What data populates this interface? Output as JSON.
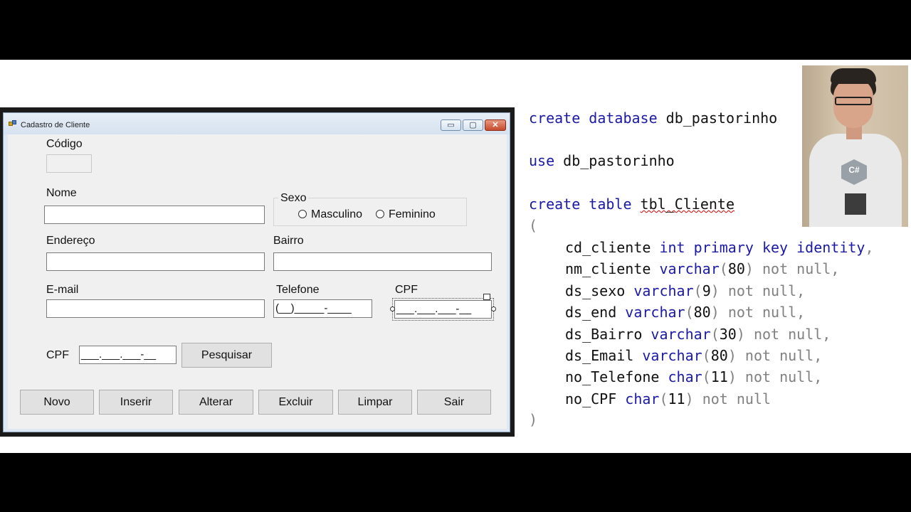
{
  "window": {
    "title": "Cadastro de Cliente",
    "minimize_glyph": "▭",
    "maximize_glyph": "▢",
    "close_glyph": "✕"
  },
  "form": {
    "codigo_label": "Código",
    "nome_label": "Nome",
    "sexo_label": "Sexo",
    "radio_masculino": "Masculino",
    "radio_feminino": "Feminino",
    "endereco_label": "Endereço",
    "bairro_label": "Bairro",
    "email_label": "E-mail",
    "telefone_label": "Telefone",
    "telefone_mask": "(__)_____-____",
    "cpf_label": "CPF",
    "cpf_mask": "___.___.___-__",
    "search_cpf_label": "CPF",
    "search_cpf_mask": "___.___.___-__",
    "pesquisar_button": "Pesquisar"
  },
  "buttons": {
    "novo": "Novo",
    "inserir": "Inserir",
    "alterar": "Alterar",
    "excluir": "Excluir",
    "limpar": "Limpar",
    "sair": "Sair"
  },
  "code": {
    "l1_kw": "create database",
    "l1_name": " db_pastorinho",
    "l2_kw": "use",
    "l2_name": " db_pastorinho",
    "l3_kw": "create table",
    "l3_name": "tbl_Cliente",
    "open_paren": "(",
    "close_paren": ")",
    "columns": [
      {
        "name": "cd_cliente",
        "type": "int primary key identity",
        "size": "",
        "tail": ","
      },
      {
        "name": "nm_cliente",
        "type": "varchar",
        "size": "80",
        "tail": " not null,"
      },
      {
        "name": "ds_sexo",
        "type": "varchar",
        "size": "9",
        "tail": " not null,"
      },
      {
        "name": "ds_end",
        "type": "varchar",
        "size": "80",
        "tail": " not null,"
      },
      {
        "name": "ds_Bairro",
        "type": "varchar",
        "size": "30",
        "tail": " not null,"
      },
      {
        "name": "ds_Email",
        "type": "varchar",
        "size": "80",
        "tail": " not null,"
      },
      {
        "name": "no_Telefone",
        "type": "char",
        "size": "11",
        "tail": " not null,"
      },
      {
        "name": "no_CPF",
        "type": "char",
        "size": "11",
        "tail": " not null"
      }
    ]
  },
  "webcam": {
    "shirt_logo": "C#"
  }
}
